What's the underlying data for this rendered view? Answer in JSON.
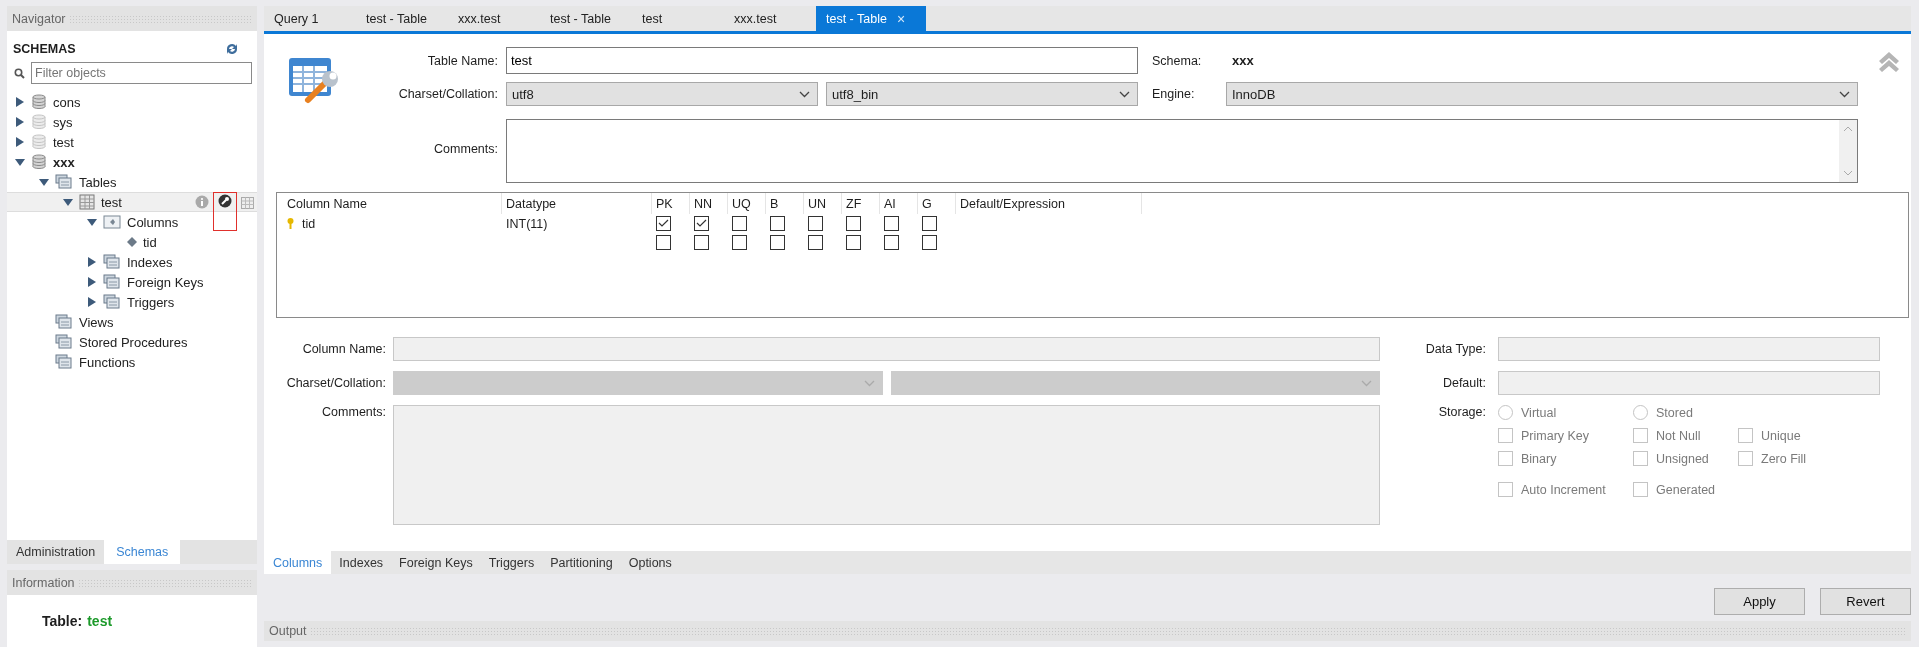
{
  "navigator": {
    "title": "Navigator",
    "heading": "SCHEMAS",
    "filter_placeholder": "Filter objects",
    "tree": [
      {
        "label": "cons",
        "kind": "schema",
        "expanded": false,
        "selected": false,
        "bold": false,
        "dimmed": false
      },
      {
        "label": "sys",
        "kind": "schema",
        "expanded": false,
        "selected": false,
        "bold": false,
        "dimmed": true
      },
      {
        "label": "test",
        "kind": "schema",
        "expanded": false,
        "selected": false,
        "bold": false,
        "dimmed": true
      },
      {
        "label": "xxx",
        "kind": "schema",
        "expanded": true,
        "selected": false,
        "bold": true,
        "dimmed": false,
        "children": [
          {
            "label": "Tables",
            "kind": "folder",
            "expanded": true,
            "selected": false,
            "children": [
              {
                "label": "test",
                "kind": "table",
                "expanded": true,
                "selected": true,
                "actions": [
                  {
                    "kind": "info",
                    "highlighted": false
                  },
                  {
                    "kind": "wrench",
                    "highlighted": true
                  },
                  {
                    "kind": "grid",
                    "highlighted": false
                  }
                ],
                "children": [
                  {
                    "label": "Columns",
                    "kind": "columns",
                    "expanded": true,
                    "selected": false,
                    "children": [
                      {
                        "label": "tid",
                        "kind": "column",
                        "selected": false
                      }
                    ]
                  },
                  {
                    "label": "Indexes",
                    "kind": "folder",
                    "expanded": false,
                    "selected": false
                  },
                  {
                    "label": "Foreign Keys",
                    "kind": "folder",
                    "expanded": false,
                    "selected": false
                  },
                  {
                    "label": "Triggers",
                    "kind": "folder",
                    "expanded": false,
                    "selected": false
                  }
                ]
              }
            ]
          },
          {
            "label": "Views",
            "kind": "folder",
            "selected": false
          },
          {
            "label": "Stored Procedures",
            "kind": "folder",
            "selected": false
          },
          {
            "label": "Functions",
            "kind": "folder",
            "selected": false
          }
        ]
      }
    ],
    "bottom_tabs": [
      {
        "label": "Administration",
        "selected": false
      },
      {
        "label": "Schemas",
        "selected": true
      }
    ],
    "information": {
      "title": "Information",
      "label": "Table:",
      "value": "test"
    }
  },
  "tabs": [
    {
      "label": "Query 1",
      "selected": false
    },
    {
      "label": "test - Table",
      "selected": false
    },
    {
      "label": "xxx.test",
      "selected": false
    },
    {
      "label": "test - Table",
      "selected": false
    },
    {
      "label": "test",
      "selected": false
    },
    {
      "label": "xxx.test",
      "selected": false
    },
    {
      "label": "test - Table",
      "selected": true,
      "close": "×"
    }
  ],
  "table_form": {
    "table_name_label": "Table Name:",
    "table_name": "test",
    "charset_label": "Charset/Collation:",
    "charset": "utf8",
    "collation": "utf8_bin",
    "comments_label": "Comments:",
    "schema_label": "Schema:",
    "schema": "xxx",
    "engine_label": "Engine:",
    "engine": "InnoDB"
  },
  "columns_grid": {
    "columns": [
      "Column Name",
      "Datatype",
      "PK",
      "NN",
      "UQ",
      "B",
      "UN",
      "ZF",
      "AI",
      "G",
      "Default/Expression"
    ],
    "rows": [
      {
        "name": "tid",
        "primary_key": true,
        "datatype": "INT(11)",
        "flags": [
          true,
          true,
          false,
          false,
          false,
          false,
          false,
          false
        ]
      },
      {
        "primary_key": false,
        "flags": [
          false,
          false,
          false,
          false,
          false,
          false,
          false,
          false
        ]
      }
    ]
  },
  "column_form": {
    "column_name_label": "Column Name:",
    "charset_label": "Charset/Collation:",
    "comments_label": "Comments:",
    "data_type_label": "Data Type:",
    "default_label": "Default:",
    "storage_label": "Storage:",
    "storage": [
      {
        "label": "Virtual",
        "selected": false
      },
      {
        "label": "Stored",
        "selected": false
      }
    ],
    "options": [
      {
        "label": "Primary Key",
        "checked": false
      },
      {
        "label": "Not Null",
        "checked": false
      },
      {
        "label": "Unique",
        "checked": false
      },
      {
        "label": "Binary",
        "checked": false
      },
      {
        "label": "Unsigned",
        "checked": false
      },
      {
        "label": "Zero Fill",
        "checked": false
      },
      {
        "label": "Auto Increment",
        "checked": false
      },
      {
        "label": "Generated",
        "checked": false
      }
    ]
  },
  "editor_tabs": [
    {
      "label": "Columns",
      "selected": true
    },
    {
      "label": "Indexes",
      "selected": false
    },
    {
      "label": "Foreign Keys",
      "selected": false
    },
    {
      "label": "Triggers",
      "selected": false
    },
    {
      "label": "Partitioning",
      "selected": false
    },
    {
      "label": "Options",
      "selected": false
    }
  ],
  "buttons": [
    "Apply",
    "Revert"
  ],
  "output": {
    "title": "Output"
  }
}
